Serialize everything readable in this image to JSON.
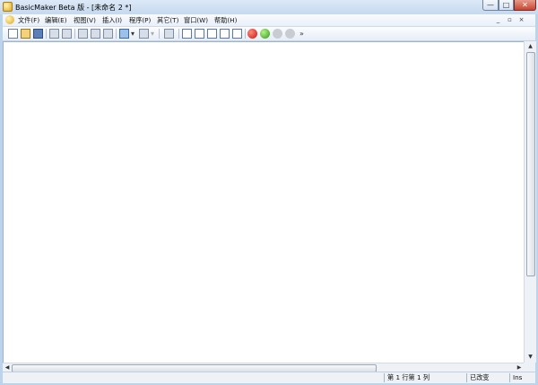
{
  "window": {
    "title": "BasicMaker Beta 版 - [未命名 2 *]",
    "min_label": "—",
    "max_label": "□",
    "close_label": "✕"
  },
  "menubar": {
    "items": [
      "文件(F)",
      "编辑(E)",
      "视图(V)",
      "插入(I)",
      "程序(P)",
      "其它(T)",
      "窗口(W)",
      "帮助(H)"
    ],
    "mdi_min": "_",
    "mdi_restore": "▫",
    "mdi_close": "×"
  },
  "toolbar": {
    "icons": [
      "new-icon",
      "open-icon",
      "save-icon",
      "print-icon",
      "print-preview-icon",
      "cut-icon",
      "copy-icon",
      "paste-icon",
      "undo-icon",
      "redo-icon",
      "find-icon",
      "indent-icon",
      "outdent-icon",
      "comment-icon",
      "uncomment-icon",
      "bookmark-icon",
      "stop-icon",
      "run-icon",
      "step-icon",
      "pause-icon"
    ],
    "binoculars_glyph": "🔭",
    "dropdown_glyph": "▾",
    "overflow_glyph": "»"
  },
  "scrollbars": {
    "up": "▲",
    "down": "▼",
    "left": "◀",
    "right": "▶"
  },
  "statusbar": {
    "position": "第 1 行第 1 列",
    "modified": "已改变",
    "mode": "Ins"
  }
}
